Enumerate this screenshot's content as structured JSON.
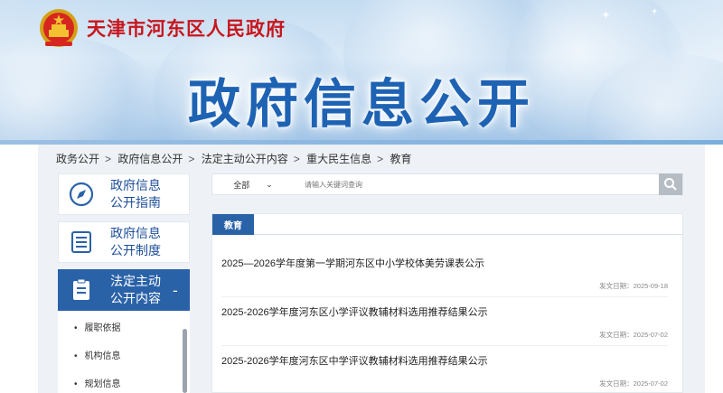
{
  "header": {
    "site_name": "天津市河东区人民政府",
    "banner_title": "政府信息公开",
    "emblem_icon": "national-emblem-icon"
  },
  "breadcrumb": [
    "政务公开",
    "政府信息公开",
    "法定主动公开内容",
    "重大民生信息",
    "教育"
  ],
  "breadcrumb_sep": ">",
  "sidebar": {
    "items": [
      {
        "label": "政府信息公开指南",
        "line1": "政府信息",
        "line2": "公开指南",
        "icon": "compass-icon"
      },
      {
        "label": "政府信息公开制度",
        "line1": "政府信息",
        "line2": "公开制度",
        "icon": "list-document-icon"
      },
      {
        "label": "法定主动公开内容",
        "line1": "法定主动",
        "line2": "公开内容",
        "icon": "clipboard-icon",
        "active": true,
        "toggle": "-"
      }
    ],
    "sub_items": [
      "履职依据",
      "机构信息",
      "规划信息"
    ]
  },
  "search": {
    "scope": "全部",
    "placeholder": "请输入关键词查询"
  },
  "panel": {
    "tab": "教育",
    "articles": [
      {
        "title": "2025—2026学年度第一学期河东区中小学校体美劳课表公示",
        "date": "发文日期：2025-09-18"
      },
      {
        "title": "2025-2026学年度河东区小学评议教辅材料选用推荐结果公示",
        "date": "发文日期：2025-07-02"
      },
      {
        "title": "2025-2026学年度河东区中学评议教辅材料选用推荐结果公示",
        "date": "发文日期：2025-07-02"
      }
    ]
  },
  "colors": {
    "brand_red": "#c8161d",
    "title_blue": "#1e62b3",
    "accent_blue": "#2a62a8"
  }
}
